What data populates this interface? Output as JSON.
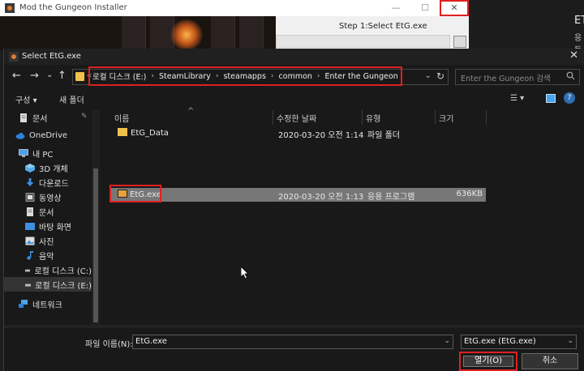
{
  "installer": {
    "title": "Mod the Gungeon Installer",
    "step": "Step 1:Select EtG.exe",
    "ctrl_min": "—",
    "ctrl_max": "☐",
    "ctrl_close": "✕"
  },
  "right_pane": {
    "t1": "ET",
    "t2": "응등"
  },
  "dialog": {
    "title": "Select EtG.exe",
    "close": "✕"
  },
  "nav_buttons": {
    "back": "←",
    "forward": "→",
    "dropdown": "⌄",
    "up": "↑"
  },
  "address": {
    "overflow": "«",
    "crumbs": [
      "로컬 디스크 (E:)",
      "SteamLibrary",
      "steamapps",
      "common",
      "Enter the Gungeon"
    ],
    "separator": "›",
    "dropdown": "⌄",
    "refresh": "↻"
  },
  "search": {
    "placeholder": "Enter the Gungeon 검색",
    "icon": "search-icon"
  },
  "toolbar": {
    "organize": "구성 ▾",
    "new_folder": "새 폴더",
    "view": "☰ ▾",
    "help": "?"
  },
  "sidebar": {
    "items": [
      {
        "label": "문서",
        "icon": "document-icon"
      },
      {
        "label": "OneDrive",
        "icon": "cloud-icon"
      },
      {
        "label": "내 PC",
        "icon": "pc-icon"
      },
      {
        "label": "3D 개체",
        "icon": "cube-icon"
      },
      {
        "label": "다운로드",
        "icon": "download-icon"
      },
      {
        "label": "동영상",
        "icon": "video-icon"
      },
      {
        "label": "문서",
        "icon": "document-icon"
      },
      {
        "label": "바탕 화면",
        "icon": "desktop-icon"
      },
      {
        "label": "사진",
        "icon": "picture-icon"
      },
      {
        "label": "음악",
        "icon": "music-icon"
      },
      {
        "label": "로컬 디스크 (C:)",
        "icon": "drive-icon"
      },
      {
        "label": "로컬 디스크 (E:)",
        "icon": "drive-icon"
      },
      {
        "label": "네트워크",
        "icon": "network-icon"
      }
    ],
    "pin": "📌"
  },
  "table": {
    "columns": [
      "이름",
      "수정한 날짜",
      "유형",
      "크기"
    ],
    "sort_indicator": "^",
    "rows": [
      {
        "name": "EtG_Data",
        "date": "2020-03-20 오전 1:14",
        "type": "파일 폴더",
        "size": ""
      },
      {
        "name": "EtG.exe",
        "date": "2020-03-20 오전 1:13",
        "type": "응용 프로그램",
        "size": "636KB"
      }
    ]
  },
  "bottom": {
    "filename_label": "파일 이름(N):",
    "filename_value": "EtG.exe",
    "filetype_value": "EtG.exe (EtG.exe)",
    "open_label": "열기(O)",
    "cancel_label": "취소",
    "dropdown": "⌄"
  }
}
